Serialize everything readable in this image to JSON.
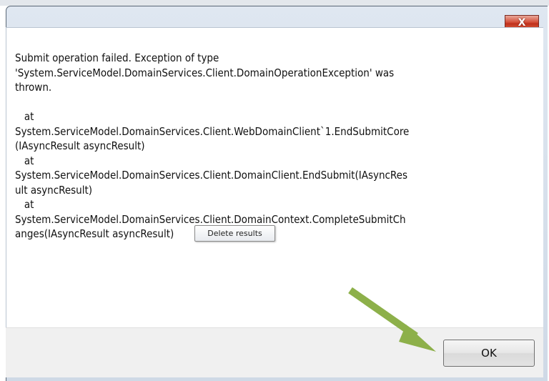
{
  "dialog": {
    "close_symbol": "X",
    "close_icon": "close-icon",
    "message_lines": [
      "Submit operation failed. Exception of type",
      "'System.ServiceModel.DomainServices.Client.DomainOperationException' was",
      "thrown.",
      "",
      "   at",
      "System.ServiceModel.DomainServices.Client.WebDomainClient`1.EndSubmitCore",
      "(IAsyncResult asyncResult)",
      "   at",
      "System.ServiceModel.DomainServices.Client.DomainClient.EndSubmit(IAsyncRes",
      "ult asyncResult)",
      "   at",
      "System.ServiceModel.DomainServices.Client.DomainContext.CompleteSubmitCh",
      "anges(IAsyncResult asyncResult)"
    ],
    "ok_label": "OK"
  },
  "tooltip": {
    "text": "Delete results"
  },
  "annotation": {
    "arrow_color": "#8db04a",
    "arrow_icon": "arrow-pointer-icon"
  }
}
